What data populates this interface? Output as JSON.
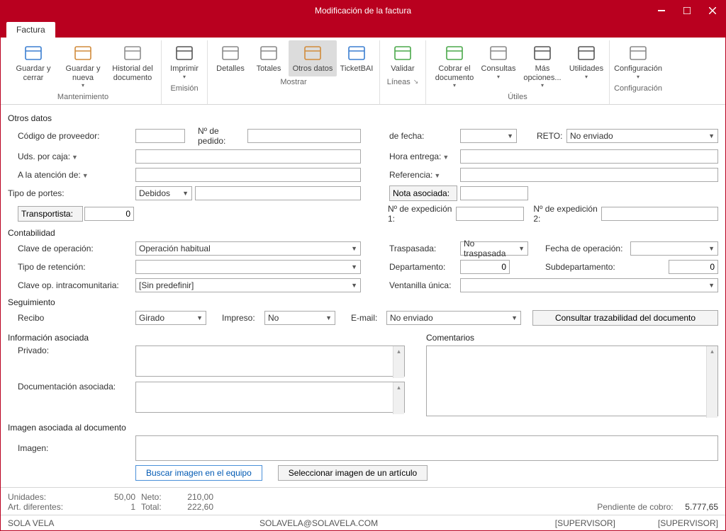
{
  "window": {
    "title": "Modificación de la factura"
  },
  "tab": {
    "label": "Factura"
  },
  "ribbon": {
    "groups": [
      {
        "label": "Mantenimiento",
        "items": [
          {
            "id": "guardar-cerrar",
            "label": "Guardar y cerrar",
            "color": "#3b7fd1"
          },
          {
            "id": "guardar-nueva",
            "label": "Guardar y nueva",
            "drop": true,
            "color": "#d18b3b"
          },
          {
            "id": "historial",
            "label": "Historial del documento",
            "color": "#8d8d8d"
          }
        ]
      },
      {
        "label": "Emisión",
        "items": [
          {
            "id": "imprimir",
            "label": "Imprimir",
            "drop": true,
            "color": "#555"
          }
        ]
      },
      {
        "label": "Mostrar",
        "items": [
          {
            "id": "detalles",
            "label": "Detalles",
            "color": "#888"
          },
          {
            "id": "totales",
            "label": "Totales",
            "color": "#888"
          },
          {
            "id": "otros-datos",
            "label": "Otros datos",
            "active": true,
            "color": "#d18b3b"
          },
          {
            "id": "ticketbai",
            "label": "TicketBAI",
            "color": "#3b7fd1"
          }
        ]
      },
      {
        "label": "Líneas",
        "launcher": true,
        "items": [
          {
            "id": "validar",
            "label": "Validar",
            "color": "#4aa84a"
          }
        ]
      },
      {
        "label": "Útiles",
        "items": [
          {
            "id": "cobrar",
            "label": "Cobrar el documento",
            "drop": true,
            "color": "#4aa84a"
          },
          {
            "id": "consultas",
            "label": "Consultas",
            "drop": true,
            "color": "#888"
          },
          {
            "id": "mas",
            "label": "Más opciones...",
            "drop": true,
            "color": "#555"
          },
          {
            "id": "utilidades",
            "label": "Utilidades",
            "drop": true,
            "color": "#555"
          }
        ]
      },
      {
        "label": "Configuración",
        "items": [
          {
            "id": "config",
            "label": "Configuración",
            "drop": true,
            "color": "#888"
          }
        ]
      }
    ]
  },
  "form": {
    "otros_datos": {
      "title": "Otros datos",
      "codigo_proveedor_label": "Código de proveedor:",
      "codigo_proveedor": "",
      "n_pedido_label": "Nº de pedido:",
      "n_pedido": "",
      "de_fecha_label": "de fecha:",
      "de_fecha": "",
      "reto_label": "RETO:",
      "reto": "No enviado",
      "uds_caja_label": "Uds. por caja:",
      "uds_caja": "",
      "hora_entrega_label": "Hora entrega:",
      "hora_entrega": "",
      "atencion_label": "A la atención de:",
      "atencion": "",
      "referencia_label": "Referencia:",
      "referencia": "",
      "tipo_portes_label": "Tipo de portes:",
      "tipo_portes": "Debidos",
      "portes_extra": "",
      "nota_btn": "Nota asociada:",
      "nota_val": "",
      "transportista_btn": "Transportista:",
      "transportista_val": "0",
      "n_exp1_label": "Nº de expedición 1:",
      "n_exp1": "",
      "n_exp2_label": "Nº de expedición 2:",
      "n_exp2": ""
    },
    "contabilidad": {
      "title": "Contabilidad",
      "clave_op_label": "Clave de operación:",
      "clave_op": "Operación habitual",
      "traspasada_label": "Traspasada:",
      "traspasada": "No traspasada",
      "fecha_op_label": "Fecha de operación:",
      "fecha_op": "",
      "tipo_ret_label": "Tipo de retención:",
      "tipo_ret": "",
      "departamento_label": "Departamento:",
      "departamento": "0",
      "subdepartamento_label": "Subdepartamento:",
      "subdepartamento": "0",
      "clave_intra_label": "Clave op. intracomunitaria:",
      "clave_intra": "[Sin predefinir]",
      "ventanilla_label": "Ventanilla única:",
      "ventanilla": ""
    },
    "seguimiento": {
      "title": "Seguimiento",
      "recibo_label": "Recibo",
      "recibo": "Girado",
      "impreso_label": "Impreso:",
      "impreso": "No",
      "email_label": "E-mail:",
      "email": "No enviado",
      "trazabilidad_btn": "Consultar trazabilidad del documento"
    },
    "info": {
      "title": "Información asociada",
      "privado_label": "Privado:",
      "doc_label": "Documentación asociada:",
      "comentarios_title": "Comentarios"
    },
    "imagen": {
      "title": "Imagen asociada al documento",
      "imagen_label": "Imagen:",
      "buscar_btn": "Buscar imagen en el equipo",
      "seleccionar_btn": "Seleccionar imagen de un artículo"
    }
  },
  "footer": {
    "unidades_label": "Unidades:",
    "unidades": "50,00",
    "neto_label": "Neto:",
    "neto": "210,00",
    "art_label": "Art. diferentes:",
    "art": "1",
    "total_label": "Total:",
    "total": "222,60",
    "pendiente_label": "Pendiente de cobro:",
    "pendiente": "5.777,65"
  },
  "status": {
    "left": "SOLA VELA",
    "center": "SOLAVELA@SOLAVELA.COM",
    "r1": "[SUPERVISOR]",
    "r2": "[SUPERVISOR]"
  }
}
